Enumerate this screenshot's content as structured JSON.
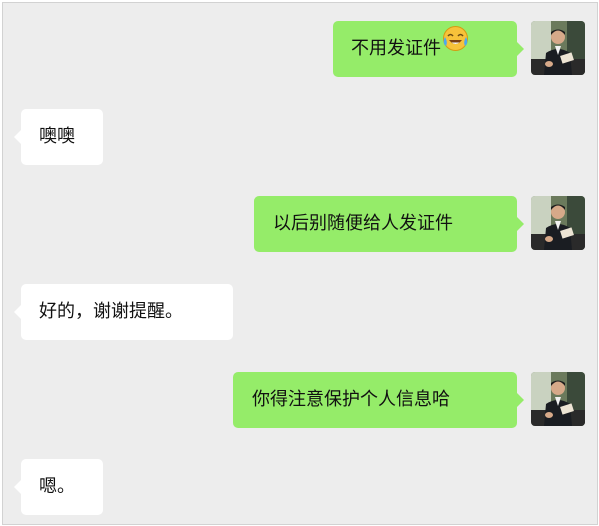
{
  "messages": [
    {
      "side": "out",
      "text": "不用发证件",
      "emoji": "laughing-with-tears"
    },
    {
      "side": "in",
      "text": "噢噢"
    },
    {
      "side": "out",
      "text": "以后别随便给人发证件"
    },
    {
      "side": "in",
      "text": "好的，谢谢提醒。"
    },
    {
      "side": "out",
      "text": "你得注意保护个人信息哈"
    },
    {
      "side": "in",
      "text": "嗯。"
    }
  ],
  "avatar": {
    "icon": "man-reading-book-avatar",
    "description_visible": false
  },
  "colors": {
    "background": "#ededed",
    "outgoing_bubble": "#95ec69",
    "incoming_bubble": "#ffffff",
    "text": "#111111"
  }
}
